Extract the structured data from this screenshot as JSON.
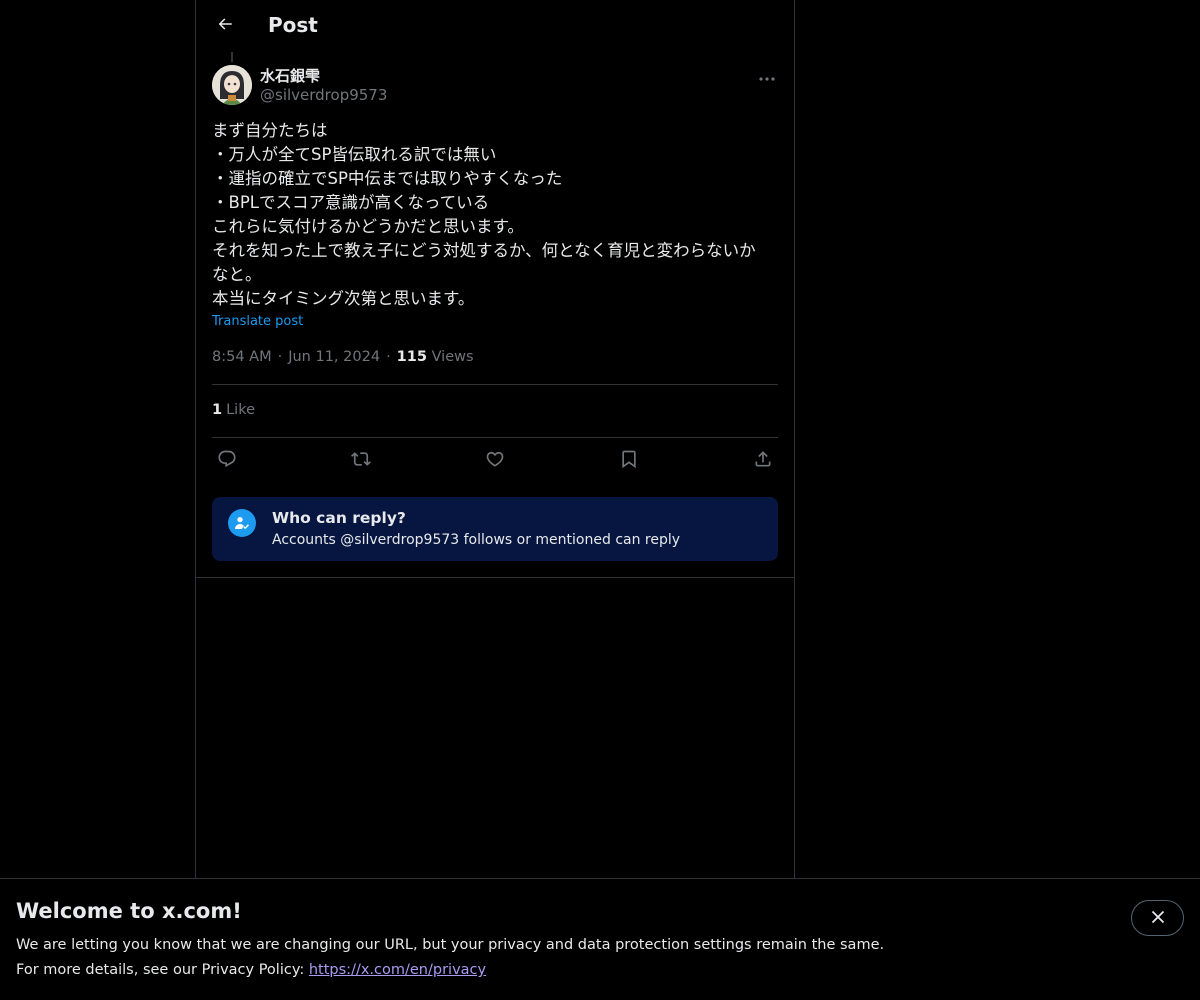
{
  "header": {
    "title": "Post"
  },
  "post": {
    "author_name": "水石銀雫",
    "author_handle": "@silverdrop9573",
    "lines": [
      "まず自分たちは",
      "・万人が全てSP皆伝取れる訳では無い",
      "・運指の確立でSP中伝までは取りやすくなった",
      "・BPLでスコア意識が高くなっている",
      "これらに気付けるかどうかだと思います。",
      "それを知った上で教え子にどう対処するか、何となく育児と変わらないか",
      "なと。",
      "本当にタイミング次第と思います。"
    ],
    "translate_label": "Translate post",
    "time": "8:54 AM",
    "date": "Jun 11, 2024",
    "views_count": "115",
    "views_label": "Views",
    "likes_count": "1",
    "likes_label": "Like"
  },
  "reply_settings": {
    "title": "Who can reply?",
    "subtitle": "Accounts @silverdrop9573 follows or mentioned can reply"
  },
  "banner": {
    "title": "Welcome to x.com!",
    "line1": "We are letting you know that we are changing our URL, but your privacy and data protection settings remain the same.",
    "line2_prefix": "For more details, see our Privacy Policy: ",
    "link": "https://x.com/en/privacy"
  },
  "colors": {
    "background": "#000000",
    "text": "#e7e9ea",
    "muted": "#71767b",
    "accent": "#1d9bf0",
    "reply_box_bg": "#061640",
    "border": "#2f3336",
    "link_visited": "#a99bf0"
  },
  "icons": {
    "back": "arrow-left-icon",
    "more": "more-horizontal-icon",
    "reply": "speech-bubble-icon",
    "repost": "repost-icon",
    "like": "heart-icon",
    "bookmark": "bookmark-icon",
    "share": "share-upload-icon",
    "reply_settings": "person-check-icon",
    "close": "close-icon"
  }
}
